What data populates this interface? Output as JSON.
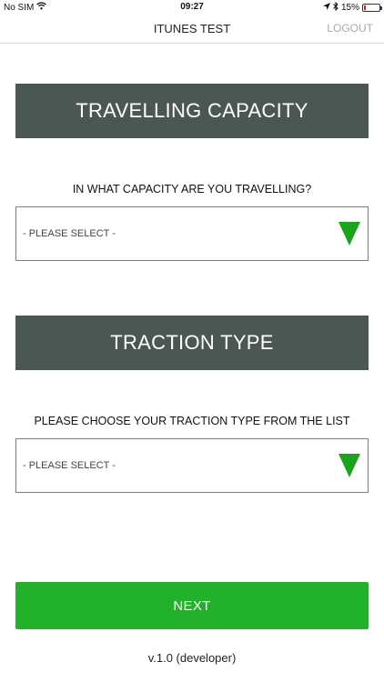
{
  "status_bar": {
    "carrier": "No SIM",
    "time": "09:27",
    "battery_text": "15%",
    "battery_level": 0.15
  },
  "nav": {
    "title": "ITUNES TEST",
    "logout_label": "LOGOUT"
  },
  "capacity": {
    "header": "TRAVELLING CAPACITY",
    "question": "IN WHAT CAPACITY ARE YOU TRAVELLING?",
    "selected": "- PLEASE SELECT -"
  },
  "traction": {
    "header": "TRACTION TYPE",
    "question": "PLEASE CHOOSE YOUR TRACTION TYPE FROM THE LIST",
    "selected": "- PLEASE SELECT -"
  },
  "footer": {
    "next_label": "NEXT",
    "version": "v.1.0 (developer)"
  },
  "colors": {
    "header_bg": "#4b5752",
    "accent_green": "#22b22a",
    "arrow_green": "#1ba31b"
  }
}
